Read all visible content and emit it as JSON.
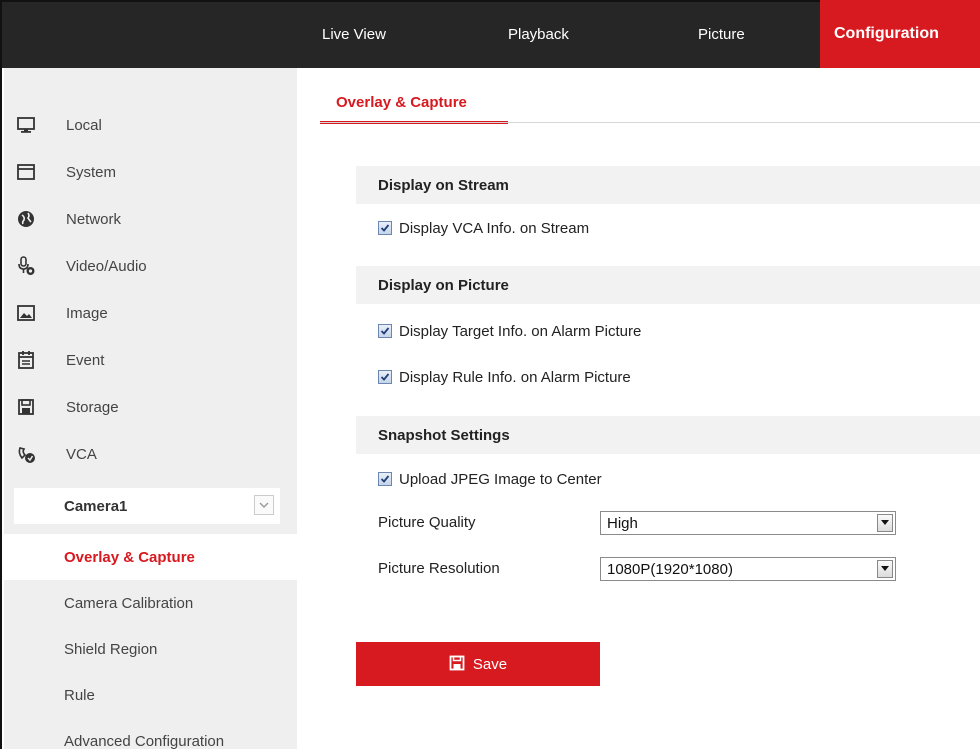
{
  "topnav": {
    "live_view": "Live View",
    "playback": "Playback",
    "picture": "Picture",
    "configuration": "Configuration"
  },
  "sidebar": {
    "items": [
      {
        "label": "Local",
        "icon": "monitor-icon"
      },
      {
        "label": "System",
        "icon": "system-window-icon"
      },
      {
        "label": "Network",
        "icon": "globe-icon"
      },
      {
        "label": "Video/Audio",
        "icon": "microphone-icon"
      },
      {
        "label": "Image",
        "icon": "image-icon"
      },
      {
        "label": "Event",
        "icon": "calendar-icon"
      },
      {
        "label": "Storage",
        "icon": "floppy-disk-icon"
      },
      {
        "label": "VCA",
        "icon": "vca-icon"
      }
    ],
    "camera": "Camera1",
    "sub_items": [
      {
        "label": "Overlay & Capture",
        "active": true
      },
      {
        "label": "Camera Calibration"
      },
      {
        "label": "Shield Region"
      },
      {
        "label": "Rule"
      },
      {
        "label": "Advanced Configuration"
      }
    ]
  },
  "main": {
    "tab": "Overlay & Capture",
    "sections": {
      "stream": {
        "title": "Display on Stream",
        "options": [
          {
            "label": "Display VCA Info. on Stream",
            "checked": true
          }
        ]
      },
      "picture": {
        "title": "Display on Picture",
        "options": [
          {
            "label": "Display Target Info. on Alarm Picture",
            "checked": true
          },
          {
            "label": "Display Rule Info. on Alarm Picture",
            "checked": true
          }
        ]
      },
      "snapshot": {
        "title": "Snapshot Settings",
        "options": [
          {
            "label": "Upload JPEG Image to Center",
            "checked": true
          }
        ],
        "quality_label": "Picture Quality",
        "quality_value": "High",
        "resolution_label": "Picture Resolution",
        "resolution_value": "1080P(1920*1080)"
      }
    },
    "save_label": "Save"
  },
  "colors": {
    "accent": "#d71920",
    "topbar": "#262626",
    "sidebar_bg": "#efefef",
    "section_bg": "#f2f2f2"
  }
}
